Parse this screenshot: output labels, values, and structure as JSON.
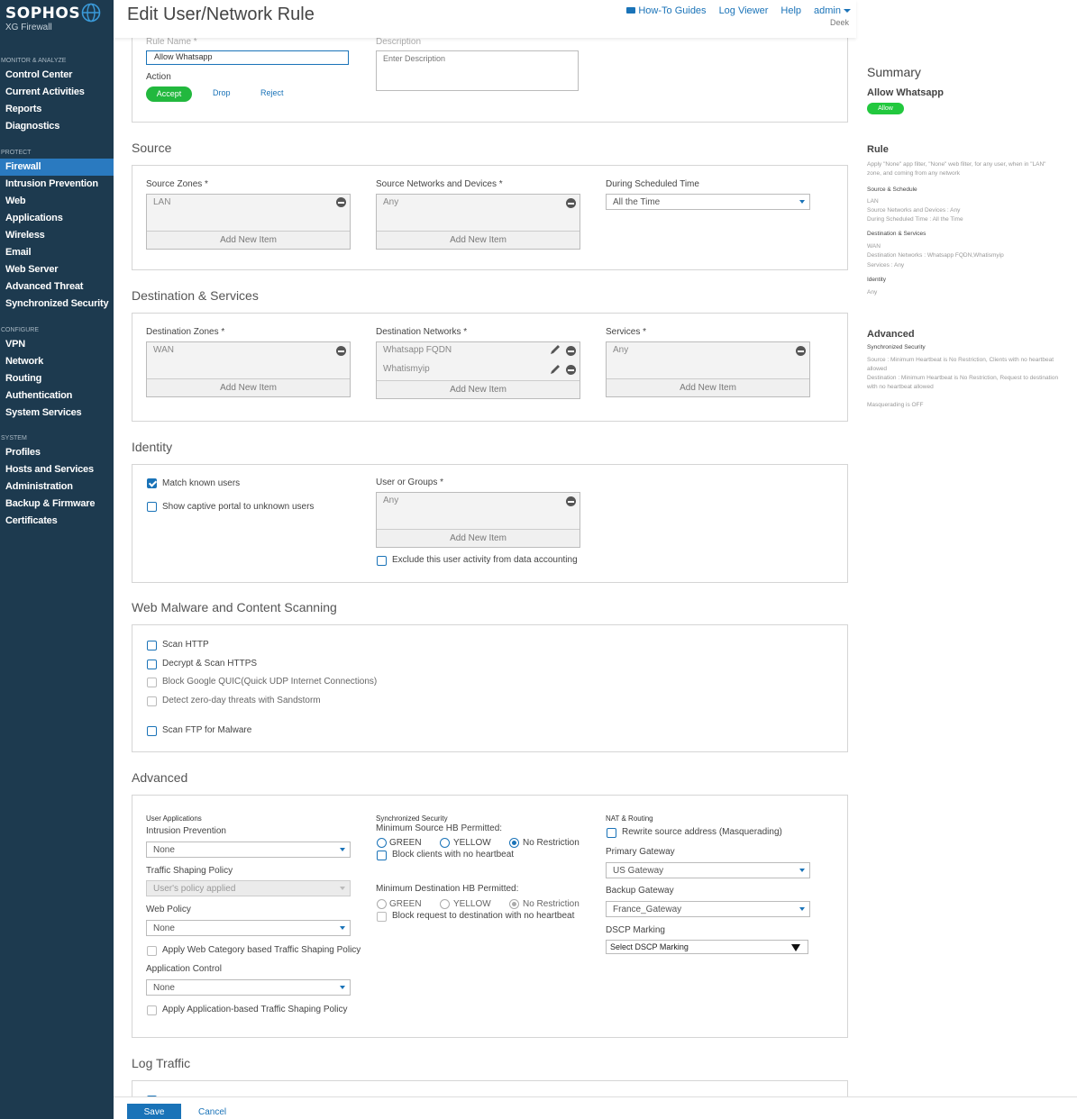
{
  "brand": {
    "name": "SOPHOS",
    "product": "XG Firewall"
  },
  "header": {
    "title": "Edit User/Network Rule",
    "howto": "How-To Guides",
    "logviewer": "Log Viewer",
    "help": "Help",
    "user": "admin",
    "device": "Deek"
  },
  "sidebar": {
    "groups": [
      {
        "heading": "MONITOR & ANALYZE",
        "items": [
          "Control Center",
          "Current Activities",
          "Reports",
          "Diagnostics"
        ]
      },
      {
        "heading": "PROTECT",
        "items": [
          "Firewall",
          "Intrusion Prevention",
          "Web",
          "Applications",
          "Wireless",
          "Email",
          "Web Server",
          "Advanced Threat",
          "Synchronized Security"
        ]
      },
      {
        "heading": "CONFIGURE",
        "items": [
          "VPN",
          "Network",
          "Routing",
          "Authentication",
          "System Services"
        ]
      },
      {
        "heading": "SYSTEM",
        "items": [
          "Profiles",
          "Hosts and Services",
          "Administration",
          "Backup & Firmware",
          "Certificates"
        ]
      }
    ],
    "active": "Firewall"
  },
  "general": {
    "rule_name_label": "Rule Name *",
    "rule_name_value": "Allow Whatsapp",
    "description_label": "Description",
    "description_placeholder": "Enter Description",
    "action_label": "Action",
    "accept": "Accept",
    "drop": "Drop",
    "reject": "Reject"
  },
  "source": {
    "title": "Source",
    "zones_label": "Source Zones *",
    "zones": [
      "LAN"
    ],
    "networks_label": "Source Networks and Devices *",
    "networks": [
      "Any"
    ],
    "schedule_label": "During Scheduled Time",
    "schedule_value": "All the Time",
    "add_new": "Add New Item"
  },
  "destination": {
    "title": "Destination & Services",
    "zones_label": "Destination Zones *",
    "zones": [
      "WAN"
    ],
    "networks_label": "Destination Networks *",
    "networks": [
      "Whatsapp FQDN",
      "Whatismyip"
    ],
    "services_label": "Services *",
    "services": [
      "Any"
    ],
    "add_new": "Add New Item"
  },
  "identity": {
    "title": "Identity",
    "match_known": "Match known users",
    "captive_portal": "Show captive portal to unknown users",
    "users_label": "User or Groups *",
    "users": [
      "Any"
    ],
    "add_new": "Add New Item",
    "exclude": "Exclude this user activity from data accounting"
  },
  "malware": {
    "title": "Web Malware and Content Scanning",
    "scan_http": "Scan HTTP",
    "decrypt_https": "Decrypt & Scan HTTPS",
    "block_quic": "Block Google QUIC(Quick UDP Internet Connections)",
    "sandstorm": "Detect zero-day threats with Sandstorm",
    "scan_ftp": "Scan FTP for Malware"
  },
  "advanced": {
    "title": "Advanced",
    "user_apps_heading": "User Applications",
    "ips_label": "Intrusion Prevention",
    "ips_value": "None",
    "traffic_shaping_label": "Traffic Shaping Policy",
    "traffic_shaping_value": "User's policy applied",
    "web_policy_label": "Web Policy",
    "web_policy_value": "None",
    "web_category_shaping": "Apply Web Category based Traffic Shaping Policy",
    "app_control_label": "Application Control",
    "app_control_value": "None",
    "app_shaping": "Apply Application-based Traffic Shaping Policy",
    "sync_heading": "Synchronized Security",
    "min_source_label": "Minimum Source HB Permitted:",
    "min_dest_label": "Minimum Destination HB Permitted:",
    "green": "GREEN",
    "yellow": "YELLOW",
    "no_restriction": "No Restriction",
    "block_clients": "Block clients with no heartbeat",
    "block_request": "Block request to destination with no heartbeat",
    "nat_heading": "NAT & Routing",
    "rewrite_source": "Rewrite source address (Masquerading)",
    "primary_gateway_label": "Primary Gateway",
    "primary_gateway_value": "US Gateway",
    "backup_gateway_label": "Backup Gateway",
    "backup_gateway_value": "France_Gateway",
    "dscp_label": "DSCP Marking",
    "dscp_value": "Select DSCP Marking"
  },
  "log": {
    "title": "Log Traffic"
  },
  "footer": {
    "save": "Save",
    "cancel": "Cancel"
  },
  "summary": {
    "title": "Summary",
    "rule_name": "Allow Whatsapp",
    "badge": "Allow",
    "rule_heading": "Rule",
    "rule_desc": "Apply \"None\" app filter, \"None\" web filter, for any user, when in \"LAN\" zone, and coming from any network",
    "source_heading": "Source & Schedule",
    "source_lines": [
      "LAN",
      "Source Networks and Devices : Any",
      "During Scheduled Time : All the Time"
    ],
    "dest_heading": "Destination & Services",
    "dest_lines": [
      "WAN",
      "Destination Networks : Whatsapp FQDN,Whatismyip",
      "Services : Any"
    ],
    "identity_heading": "Identity",
    "identity_lines": [
      "Any"
    ],
    "advanced_heading": "Advanced",
    "sync_heading": "Synchronized Security",
    "sync_source": "Source : Minimum Heartbeat is No Restriction, Clients with no heartbeat allowed",
    "sync_dest": "Destination : Minimum Heartbeat is No Restriction, Request to destination with no heartbeat allowed",
    "masq": "Masquerading is OFF"
  },
  "colors": {
    "sidebar": "#1d3a4f",
    "accent": "#1a73b8",
    "accept": "#22b83e"
  }
}
